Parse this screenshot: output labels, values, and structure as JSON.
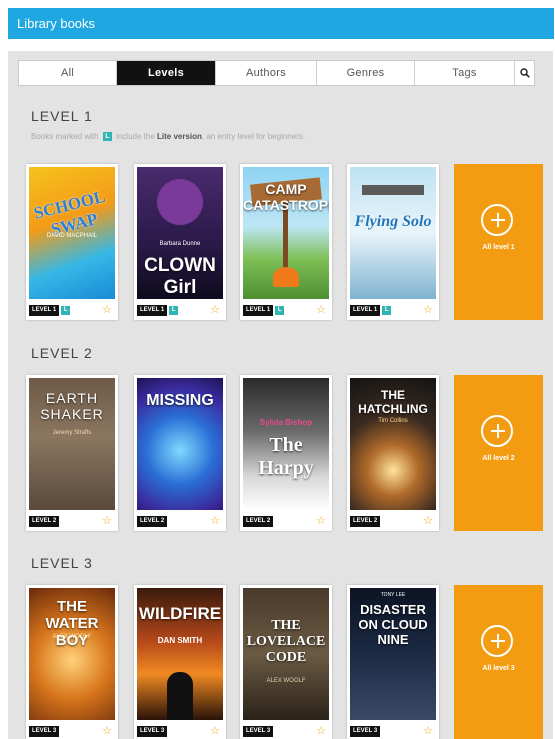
{
  "header": {
    "title": "Library books"
  },
  "tabs": [
    {
      "label": "All",
      "active": false
    },
    {
      "label": "Levels",
      "active": true
    },
    {
      "label": "Authors",
      "active": false
    },
    {
      "label": "Genres",
      "active": false
    },
    {
      "label": "Tags",
      "active": false
    }
  ],
  "search_icon": "search-icon",
  "levels": [
    {
      "title": "LEVEL 1",
      "note": {
        "prefix": "Books marked with",
        "badge": "L",
        "middle": "include the",
        "strong": "Lite version",
        "suffix": ", an entry level for beginners."
      },
      "books": [
        {
          "title": "SCHOOL SWAP",
          "author": "DAVID MACPHAIL",
          "badge": "LEVEL 1",
          "lite": "L"
        },
        {
          "title": "CLOWN Girl",
          "author": "Barbara Dunne",
          "badge": "LEVEL 1",
          "lite": "L"
        },
        {
          "title": "CAMP CATASTROPHE",
          "author": "",
          "badge": "LEVEL 1",
          "lite": "L"
        },
        {
          "title": "Flying Solo",
          "author": "",
          "badge": "LEVEL 1",
          "lite": "L"
        }
      ],
      "all_label": "All level 1"
    },
    {
      "title": "LEVEL 2",
      "books": [
        {
          "title": "EARTH SHAKER",
          "author": "Jeremy Strafts",
          "badge": "LEVEL 2"
        },
        {
          "title": "MISSING",
          "author": "",
          "badge": "LEVEL 2"
        },
        {
          "title": "The Harpy",
          "author": "Sylvia Bishop",
          "badge": "LEVEL 2"
        },
        {
          "title": "THE HATCHLING",
          "author": "Tim Collins",
          "badge": "LEVEL 2"
        }
      ],
      "all_label": "All level 2"
    },
    {
      "title": "LEVEL 3",
      "books": [
        {
          "title": "THE WATER BOY",
          "author": "ALEX WOOLF",
          "badge": "LEVEL 3"
        },
        {
          "title": "WILDFIRE",
          "author": "DAN SMITH",
          "badge": "LEVEL 3"
        },
        {
          "title": "THE LOVELACE CODE",
          "author": "ALEX WOOLF",
          "badge": "LEVEL 3"
        },
        {
          "title": "DISASTER ON CLOUD NINE",
          "author": "TONY LEE",
          "badge": "LEVEL 3"
        }
      ],
      "all_label": "All level 3"
    }
  ]
}
